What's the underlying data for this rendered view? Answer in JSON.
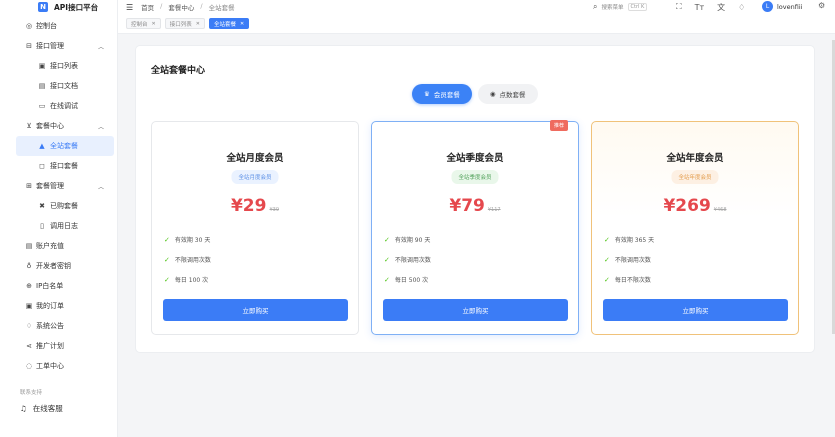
{
  "app": {
    "title": "API接口平台",
    "logo_letter": "N"
  },
  "sidebar": {
    "items": [
      {
        "label": "控制台",
        "icon": "dashboard-icon"
      },
      {
        "label": "接口管理",
        "icon": "api-icon",
        "expandable": true
      },
      {
        "label": "接口列表",
        "icon": "list-icon",
        "sub": true
      },
      {
        "label": "接口文档",
        "icon": "doc-icon",
        "sub": true
      },
      {
        "label": "在线调试",
        "icon": "monitor-icon",
        "sub": true
      },
      {
        "label": "套餐中心",
        "icon": "cart-icon",
        "expandable": true
      },
      {
        "label": "全站套餐",
        "icon": "lock-icon",
        "sub": true,
        "active": true
      },
      {
        "label": "接口套餐",
        "icon": "bag-icon",
        "sub": true
      },
      {
        "label": "套餐管理",
        "icon": "manage-icon",
        "expandable": true
      },
      {
        "label": "已购套餐",
        "icon": "purchased-icon",
        "sub": true
      },
      {
        "label": "调用日志",
        "icon": "log-icon",
        "sub": true
      },
      {
        "label": "账户充值",
        "icon": "wallet-icon"
      },
      {
        "label": "开发者密钥",
        "icon": "key-icon"
      },
      {
        "label": "IP白名单",
        "icon": "ip-icon"
      },
      {
        "label": "我的订单",
        "icon": "order-icon"
      },
      {
        "label": "系统公告",
        "icon": "bell-icon"
      },
      {
        "label": "推广计划",
        "icon": "share-icon"
      },
      {
        "label": "工单中心",
        "icon": "ticket-icon"
      }
    ],
    "section_label": "联系支持",
    "online_service": "在线客服"
  },
  "topbar": {
    "breadcrumbs": [
      "首页",
      "套餐中心",
      "全站套餐"
    ],
    "search_placeholder": "搜索菜单",
    "search_shortcut": "Ctrl K",
    "username": "lovenfiii",
    "avatar_letter": "L"
  },
  "tabs": [
    {
      "label": "控制台",
      "active": false
    },
    {
      "label": "接口列表",
      "active": false
    },
    {
      "label": "全站套餐",
      "active": true
    }
  ],
  "main": {
    "title": "全站套餐中心",
    "segments": [
      {
        "label": "会员套餐",
        "active": true
      },
      {
        "label": "点数套餐",
        "active": false
      }
    ],
    "plans": [
      {
        "name": "全站月度会员",
        "badge": "全站月度会员",
        "price": "¥29",
        "original": "¥39",
        "features": [
          "有效期 30 天",
          "不限调用次数",
          "每日 100 次"
        ],
        "button": "立即购买"
      },
      {
        "name": "全站季度会员",
        "badge": "全站季度会员",
        "price": "¥79",
        "original": "¥117",
        "hot": "推荐",
        "features": [
          "有效期 90 天",
          "不限调用次数",
          "每日 500 次"
        ],
        "button": "立即购买"
      },
      {
        "name": "全站年度会员",
        "badge": "全站年度会员",
        "price": "¥269",
        "original": "¥468",
        "features": [
          "有效期 365 天",
          "不限调用次数",
          "每日不限次数"
        ],
        "button": "立即购买"
      }
    ]
  },
  "colors": {
    "accent": "#3b7cf6",
    "price": "#e5484d",
    "check": "#52c41a"
  }
}
